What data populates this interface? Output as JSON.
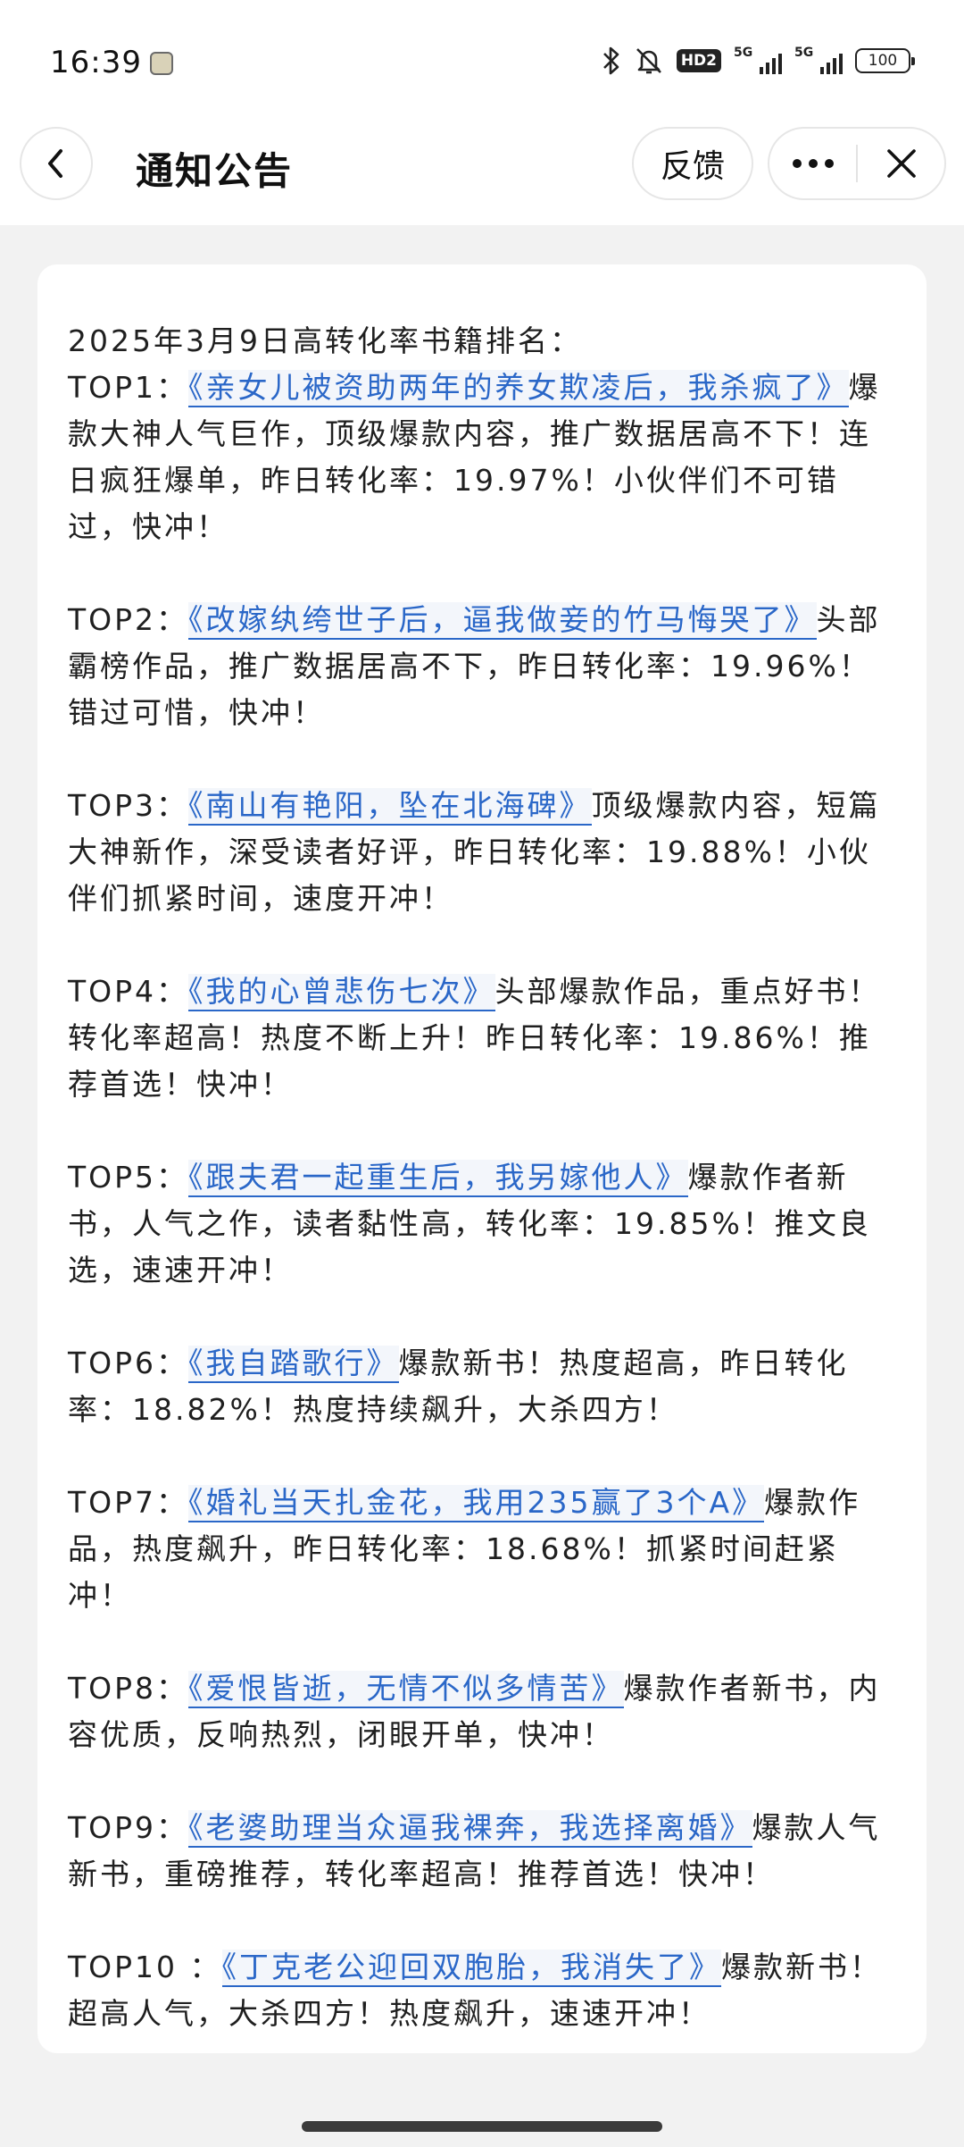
{
  "status_bar": {
    "time": "16:39",
    "hd_label": "HD2",
    "net1_label": "5G",
    "net2_label": "5G",
    "battery": "100"
  },
  "nav": {
    "title": "通知公告",
    "feedback_label": "反馈"
  },
  "notice": {
    "heading": "2025年3月9日高转化率书籍排名：",
    "items": [
      {
        "prefix": "TOP1：",
        "title": "《亲女儿被资助两年的养女欺凌后，我杀疯了》",
        "desc": "爆款大神人气巨作，顶级爆款内容，推广数据居高不下！连日疯狂爆单，昨日转化率：19.97%！小伙伴们不可错过，快冲！"
      },
      {
        "prefix": "TOP2：",
        "title": "《改嫁纨绔世子后，逼我做妾的竹马悔哭了》",
        "desc": "头部霸榜作品，推广数据居高不下，昨日转化率：19.96%！错过可惜，快冲！"
      },
      {
        "prefix": "TOP3：",
        "title": "《南山有艳阳，坠在北海碑》",
        "desc": "顶级爆款内容，短篇大神新作，深受读者好评，昨日转化率：19.88%！小伙伴们抓紧时间，速度开冲！"
      },
      {
        "prefix": "TOP4：",
        "title": "《我的心曾悲伤七次》",
        "desc": "头部爆款作品，重点好书！转化率超高！热度不断上升！昨日转化率：19.86%！推荐首选！快冲！"
      },
      {
        "prefix": "TOP5：",
        "title": "《跟夫君一起重生后，我另嫁他人》",
        "desc": "爆款作者新书，人气之作，读者黏性高，转化率：19.85%！推文良选，速速开冲！"
      },
      {
        "prefix": "TOP6：",
        "title": "《我自踏歌行》",
        "desc": "爆款新书！热度超高，昨日转化率：18.82%！热度持续飙升，大杀四方！"
      },
      {
        "prefix": "TOP7：",
        "title": "《婚礼当天扎金花，我用235赢了3个A》",
        "desc": "爆款作品，热度飙升，昨日转化率：18.68%！抓紧时间赶紧冲！"
      },
      {
        "prefix": "TOP8：",
        "title": "《爱恨皆逝，无情不似多情苦》",
        "desc": "爆款作者新书，内容优质，反响热烈，闭眼开单，快冲！"
      },
      {
        "prefix": "TOP9：",
        "title": "《老婆助理当众逼我裸奔，我选择离婚》",
        "desc": "爆款人气新书，重磅推荐，转化率超高！推荐首选！快冲！"
      },
      {
        "prefix": "TOP10 ：",
        "title": "《丁克老公迎回双胞胎，我消失了》",
        "desc": "爆款新书！超高人气，大杀四方！热度飙升，速速开冲！"
      }
    ]
  },
  "colors": {
    "link": "#2a67c8",
    "background": "#f2f2f2",
    "card": "#ffffff"
  },
  "icons": [
    "back-arrow-icon",
    "more-dots-icon",
    "close-icon",
    "bluetooth-icon",
    "mute-bell-icon",
    "signal-icon",
    "battery-icon"
  ]
}
